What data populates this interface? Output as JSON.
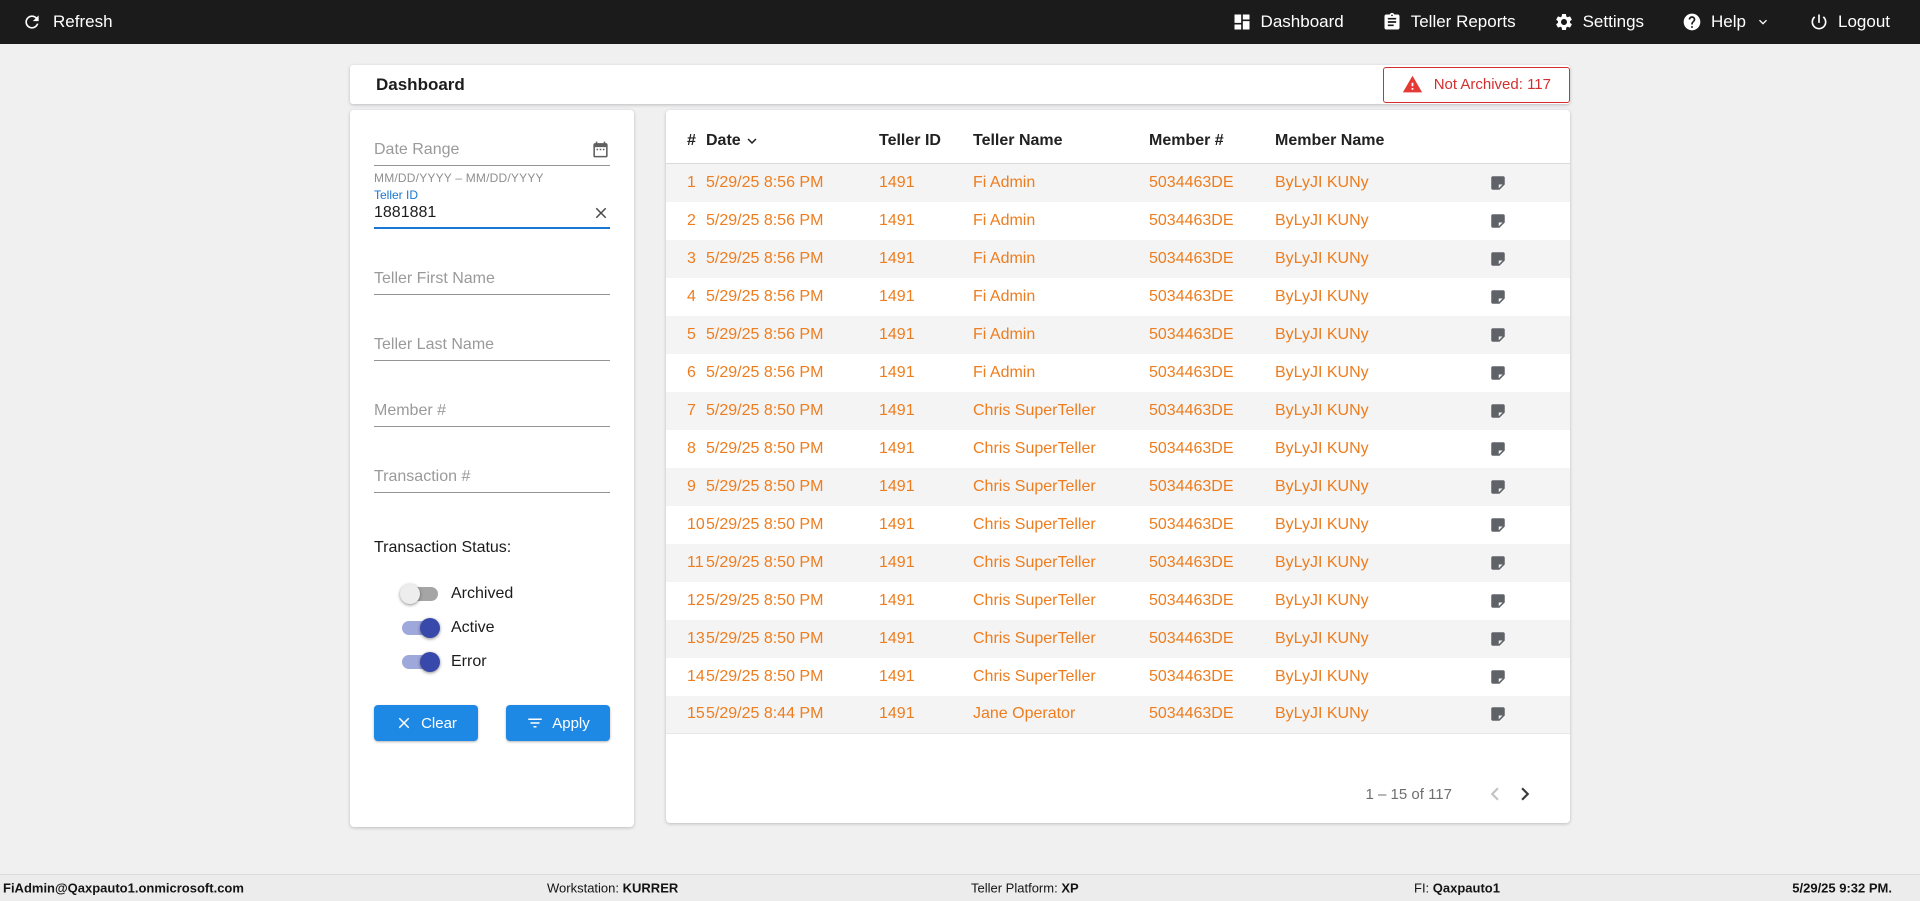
{
  "topbar": {
    "refresh_label": "Refresh",
    "nav": [
      {
        "label": "Dashboard",
        "icon": "dashboard-icon"
      },
      {
        "label": "Teller Reports",
        "icon": "reports-icon"
      },
      {
        "label": "Settings",
        "icon": "gear-icon"
      },
      {
        "label": "Help",
        "icon": "help-icon"
      },
      {
        "label": "Logout",
        "icon": "power-icon"
      }
    ]
  },
  "page": {
    "title": "Dashboard",
    "not_archived": "Not Archived: 117"
  },
  "filters": {
    "date_range_placeholder": "Date Range",
    "date_range_hint": "MM/DD/YYYY – MM/DD/YYYY",
    "teller_id_label": "Teller ID",
    "teller_id_value": "1881881",
    "teller_first_name_placeholder": "Teller First Name",
    "teller_last_name_placeholder": "Teller Last Name",
    "member_placeholder": "Member #",
    "transaction_placeholder": "Transaction #",
    "status_label": "Transaction Status:",
    "toggles": [
      {
        "label": "Archived",
        "on": false
      },
      {
        "label": "Active",
        "on": true
      },
      {
        "label": "Error",
        "on": true
      }
    ],
    "clear_label": "Clear",
    "apply_label": "Apply"
  },
  "table": {
    "columns": [
      "#",
      "Date",
      "Teller ID",
      "Teller Name",
      "Member #",
      "Member Name"
    ],
    "rows": [
      {
        "num": "1",
        "date": "5/29/25 8:56 PM",
        "teller_id": "1491",
        "teller_name": "Fi Admin",
        "member_num": "5034463DE",
        "member_name": "ByLyJI KUNy"
      },
      {
        "num": "2",
        "date": "5/29/25 8:56 PM",
        "teller_id": "1491",
        "teller_name": "Fi Admin",
        "member_num": "5034463DE",
        "member_name": "ByLyJI KUNy"
      },
      {
        "num": "3",
        "date": "5/29/25 8:56 PM",
        "teller_id": "1491",
        "teller_name": "Fi Admin",
        "member_num": "5034463DE",
        "member_name": "ByLyJI KUNy"
      },
      {
        "num": "4",
        "date": "5/29/25 8:56 PM",
        "teller_id": "1491",
        "teller_name": "Fi Admin",
        "member_num": "5034463DE",
        "member_name": "ByLyJI KUNy"
      },
      {
        "num": "5",
        "date": "5/29/25 8:56 PM",
        "teller_id": "1491",
        "teller_name": "Fi Admin",
        "member_num": "5034463DE",
        "member_name": "ByLyJI KUNy"
      },
      {
        "num": "6",
        "date": "5/29/25 8:56 PM",
        "teller_id": "1491",
        "teller_name": "Fi Admin",
        "member_num": "5034463DE",
        "member_name": "ByLyJI KUNy"
      },
      {
        "num": "7",
        "date": "5/29/25 8:50 PM",
        "teller_id": "1491",
        "teller_name": "Chris SuperTeller",
        "member_num": "5034463DE",
        "member_name": "ByLyJI KUNy"
      },
      {
        "num": "8",
        "date": "5/29/25 8:50 PM",
        "teller_id": "1491",
        "teller_name": "Chris SuperTeller",
        "member_num": "5034463DE",
        "member_name": "ByLyJI KUNy"
      },
      {
        "num": "9",
        "date": "5/29/25 8:50 PM",
        "teller_id": "1491",
        "teller_name": "Chris SuperTeller",
        "member_num": "5034463DE",
        "member_name": "ByLyJI KUNy"
      },
      {
        "num": "10",
        "date": "5/29/25 8:50 PM",
        "teller_id": "1491",
        "teller_name": "Chris SuperTeller",
        "member_num": "5034463DE",
        "member_name": "ByLyJI KUNy"
      },
      {
        "num": "11",
        "date": "5/29/25 8:50 PM",
        "teller_id": "1491",
        "teller_name": "Chris SuperTeller",
        "member_num": "5034463DE",
        "member_name": "ByLyJI KUNy"
      },
      {
        "num": "12",
        "date": "5/29/25 8:50 PM",
        "teller_id": "1491",
        "teller_name": "Chris SuperTeller",
        "member_num": "5034463DE",
        "member_name": "ByLyJI KUNy"
      },
      {
        "num": "13",
        "date": "5/29/25 8:50 PM",
        "teller_id": "1491",
        "teller_name": "Chris SuperTeller",
        "member_num": "5034463DE",
        "member_name": "ByLyJI KUNy"
      },
      {
        "num": "14",
        "date": "5/29/25 8:50 PM",
        "teller_id": "1491",
        "teller_name": "Chris SuperTeller",
        "member_num": "5034463DE",
        "member_name": "ByLyJI KUNy"
      },
      {
        "num": "15",
        "date": "5/29/25 8:44 PM",
        "teller_id": "1491",
        "teller_name": "Jane Operator",
        "member_num": "5034463DE",
        "member_name": "ByLyJI KUNy"
      }
    ],
    "pagination_range": "1 – 15 of 117"
  },
  "footer": {
    "user": "FiAdmin@Qaxpauto1.onmicrosoft.com",
    "workstation_label": "Workstation:",
    "workstation_value": "KURRER",
    "platform_label": "Teller Platform:",
    "platform_value": "XP",
    "fi_label": "FI:",
    "fi_value": "Qaxpauto1",
    "datetime": "5/29/25 9:32 PM."
  },
  "icons": {
    "refresh": "circular-arrow",
    "dashboard": "grid-squares",
    "teller_reports": "clipboard-list",
    "settings": "gear",
    "help": "question-circle",
    "help_caret": "chevron-down",
    "logout": "power",
    "date_range": "calendar",
    "teller_id_clear": "x",
    "not_archived": "warning-triangle",
    "date_sort": "chevron-down",
    "clear_button": "x",
    "apply_button": "filter-lines",
    "row_note": "sticky-note",
    "prev_page": "chevron-left",
    "next_page": "chevron-right"
  },
  "colors": {
    "topbar_bg": "#1b1b1b",
    "accent_blue": "#1e88e5",
    "focus_blue": "#1976d2",
    "row_text_orange": "#ed7d1f",
    "alert_red": "#d32f2f",
    "toggle_on_thumb": "#3949ab",
    "main_bg": "#f0f0f1"
  }
}
